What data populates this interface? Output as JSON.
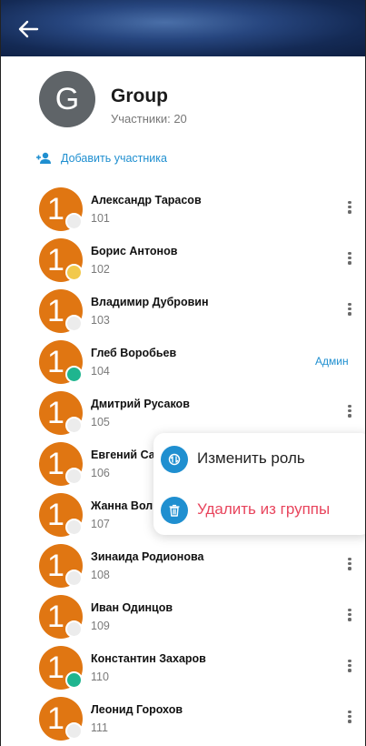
{
  "group": {
    "avatar_letter": "G",
    "name": "Group",
    "participants": "Участники: 20"
  },
  "add_member_label": "Добавить участника",
  "members": [
    {
      "avatar": "1",
      "name": "Александр Тарасов",
      "number": "101",
      "status": "offline",
      "menu_icon": "kebab-icon"
    },
    {
      "avatar": "1",
      "name": "Борис Антонов",
      "number": "102",
      "status": "away",
      "menu_icon": "kebab-icon"
    },
    {
      "avatar": "1",
      "name": "Владимир Дубровин",
      "number": "103",
      "status": "offline",
      "menu_icon": "kebab-icon"
    },
    {
      "avatar": "1",
      "name": "Глеб Воробьев",
      "number": "104",
      "status": "online",
      "role": "Админ"
    },
    {
      "avatar": "1",
      "name": "Дмитрий Русаков",
      "number": "105",
      "status": "offline",
      "menu_icon": "kebab-icon"
    },
    {
      "avatar": "1",
      "name": "Евгений Саф",
      "number": "106",
      "status": "offline"
    },
    {
      "avatar": "1",
      "name": "Жанна Волк",
      "number": "107",
      "status": "offline"
    },
    {
      "avatar": "1",
      "name": "Зинаида Родионова",
      "number": "108",
      "status": "offline",
      "menu_icon": "kebab-icon"
    },
    {
      "avatar": "1",
      "name": "Иван Одинцов",
      "number": "109",
      "status": "offline",
      "menu_icon": "kebab-icon"
    },
    {
      "avatar": "1",
      "name": "Константин Захаров",
      "number": "110",
      "status": "online",
      "menu_icon": "kebab-icon"
    },
    {
      "avatar": "1",
      "name": "Леонид Горохов",
      "number": "111",
      "status": "offline",
      "menu_icon": "kebab-icon"
    }
  ],
  "context_menu": {
    "change_role": "Изменить роль",
    "remove_from_group": "Удалить из группы"
  },
  "colors": {
    "accent": "#1f8fd0",
    "danger": "#e8455d",
    "avatar_orange": "#e07612",
    "status_online": "#1fb58f",
    "status_away": "#f2c94c",
    "status_offline": "#ececec",
    "group_avatar": "#5f6468"
  },
  "icons": {
    "back": "arrow-left-icon",
    "add_member": "add-person-icon",
    "change_role": "role-switch-icon",
    "remove": "trash-icon"
  }
}
